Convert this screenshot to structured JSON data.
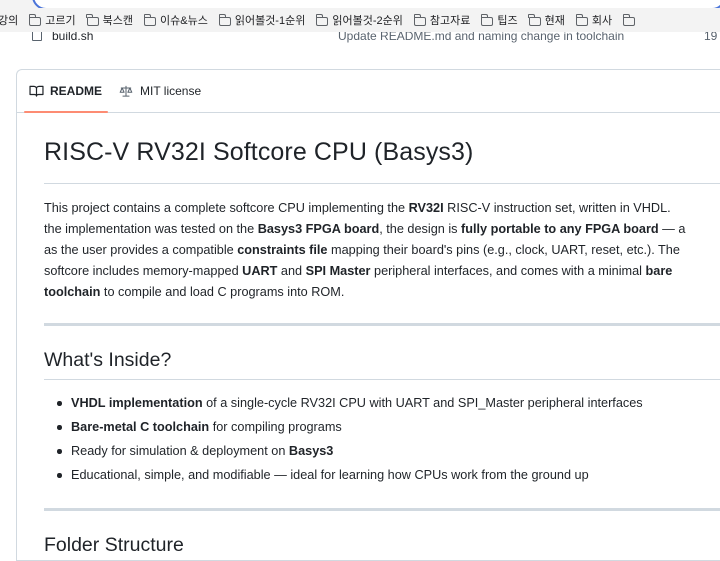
{
  "bookmarks": [
    "강의",
    "고르기",
    "북스캔",
    "이슈&뉴스",
    "읽어볼것-1순위",
    "읽어볼것-2순위",
    "참고자료",
    "팁즈",
    "현재",
    "회사",
    ""
  ],
  "file_row": {
    "name": "build.sh",
    "message": "Update README.md and naming change in toolchain",
    "age": "19"
  },
  "tabs": {
    "readme": "README",
    "license": "MIT license"
  },
  "readme": {
    "title": "RISC-V RV32I Softcore CPU (Basys3)",
    "intro": {
      "l1a": "This project contains a complete softcore CPU implementing the ",
      "l1b": "RV32I",
      "l1c": " RISC-V instruction set, written in VHDL.",
      "l2a": "the implementation was tested on the ",
      "l2b": "Basys3 FPGA board",
      "l2c": ", the design is ",
      "l2d": "fully portable to any FPGA board",
      "l2e": " — a",
      "l3a": "as the user provides a compatible ",
      "l3b": "constraints file",
      "l3c": " mapping their board's pins (e.g., clock, UART, reset, etc.). The",
      "l4a": "softcore includes memory-mapped ",
      "l4b": "UART",
      "l4c": " and ",
      "l4d": "SPI Master",
      "l4e": " peripheral interfaces, and comes with a minimal ",
      "l4f": "bare",
      "l5a": "toolchain",
      "l5b": " to compile and load C programs into ROM."
    },
    "section1": "What's Inside?",
    "bullets": [
      {
        "bold": "VHDL implementation",
        "rest": " of a single-cycle RV32I CPU with UART and SPI_Master peripheral interfaces"
      },
      {
        "bold": "Bare-metal C toolchain",
        "rest": " for compiling programs"
      },
      {
        "pre": "Ready for simulation & deployment on ",
        "bold": "Basys3"
      },
      {
        "pre": "Educational, simple, and modifiable — ideal for learning how CPUs work from the ground up"
      }
    ],
    "section2": "Folder Structure"
  }
}
